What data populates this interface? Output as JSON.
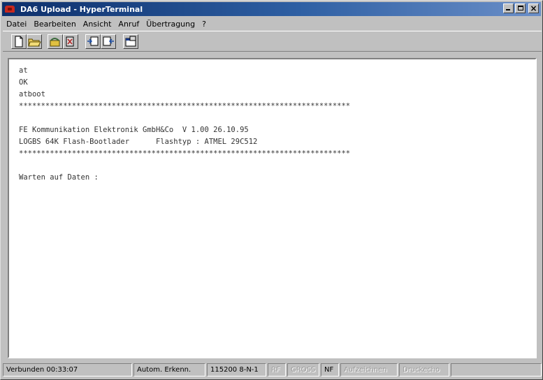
{
  "window": {
    "title": "DA6 Upload - HyperTerminal"
  },
  "menubar": {
    "items": [
      {
        "label": "Datei"
      },
      {
        "label": "Bearbeiten"
      },
      {
        "label": "Ansicht"
      },
      {
        "label": "Anruf"
      },
      {
        "label": "Übertragung"
      },
      {
        "label": "?"
      }
    ]
  },
  "terminal": {
    "lines": [
      "at",
      "OK",
      "atboot",
      "***************************************************************************",
      "",
      "FE Kommunikation Elektronik GmbH&Co  V 1.00 26.10.95",
      "LOGBS 64K Flash-Bootlader      Flashtyp : ATMEL 29C512",
      "***************************************************************************",
      "",
      "Warten auf Daten :"
    ]
  },
  "statusbar": {
    "connected": "Verbunden 00:33:07",
    "autodetect": "Autom. Erkenn.",
    "settings": "115200 8-N-1",
    "scroll": "RF",
    "caps": "GROSS",
    "num": "NF",
    "capture": "Aufzeichnen",
    "print_echo": "Druckecho"
  }
}
